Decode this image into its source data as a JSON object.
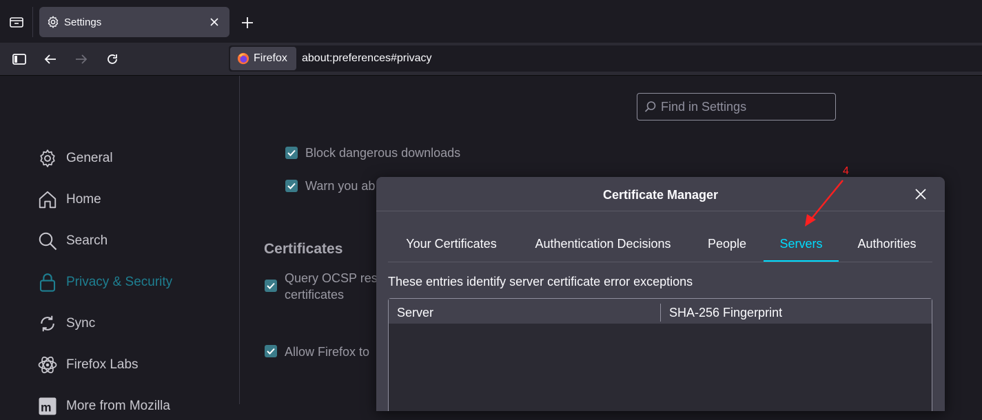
{
  "browser": {
    "tab_title": "Settings",
    "identity_label": "Firefox",
    "url": "about:preferences#privacy"
  },
  "sidebar": {
    "items": [
      {
        "label": "General",
        "icon": "gear-icon"
      },
      {
        "label": "Home",
        "icon": "home-icon"
      },
      {
        "label": "Search",
        "icon": "search-icon"
      },
      {
        "label": "Privacy & Security",
        "icon": "lock-icon",
        "active": true
      },
      {
        "label": "Sync",
        "icon": "sync-icon"
      },
      {
        "label": "Firefox Labs",
        "icon": "labs-icon"
      },
      {
        "label": "More from Mozilla",
        "icon": "mozilla-icon"
      }
    ]
  },
  "search": {
    "placeholder": "Find in Settings"
  },
  "prefs": {
    "block_downloads": "Block dangerous downloads",
    "warn_unwanted": "Warn you ab",
    "certificates_title": "Certificates",
    "ocsp_line1": "Query OCSP resp",
    "ocsp_line2": "certificates",
    "allow_firefox": "Allow Firefox to"
  },
  "dialog": {
    "title": "Certificate Manager",
    "tabs": [
      {
        "label": "Your Certificates"
      },
      {
        "label": "Authentication Decisions"
      },
      {
        "label": "People"
      },
      {
        "label": "Servers",
        "active": true
      },
      {
        "label": "Authorities"
      }
    ],
    "description": "These entries identify server certificate error exceptions",
    "columns": [
      "Server",
      "SHA-256 Fingerprint"
    ]
  },
  "annotation": {
    "number": "4",
    "color": "#ff2020"
  },
  "colors": {
    "accent": "#00ddff",
    "checkbox": "#3a7b89",
    "active_nav": "#1e7f91"
  }
}
